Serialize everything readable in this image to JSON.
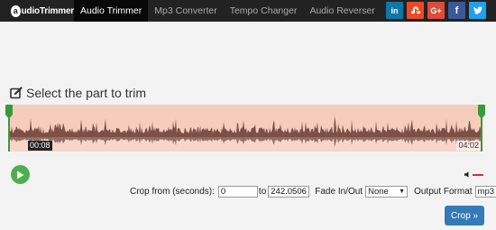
{
  "brand": {
    "logo_letter": "a",
    "logo_text": "udioTrimmer"
  },
  "nav": {
    "items": [
      {
        "label": "Audio Trimmer",
        "active": true
      },
      {
        "label": "Mp3 Converter",
        "active": false
      },
      {
        "label": "Tempo Changer",
        "active": false
      },
      {
        "label": "Audio Reverser",
        "active": false
      }
    ]
  },
  "social": [
    {
      "name": "linkedin",
      "label": "in",
      "color": "#0e76a8"
    },
    {
      "name": "stumbleupon",
      "label": "su",
      "color": "#eb4924"
    },
    {
      "name": "google-plus",
      "label": "G+",
      "color": "#dd4b39"
    },
    {
      "name": "facebook",
      "label": "f",
      "color": "#3b5998"
    },
    {
      "name": "twitter",
      "label": "t",
      "color": "#1da1f2"
    }
  ],
  "editor": {
    "heading": "Select the part to trim",
    "time_start": "00:08",
    "time_end": "04:02"
  },
  "crop": {
    "from_label": "Crop from (seconds):",
    "from_value": "0",
    "to_label": "to",
    "to_value": "242.0506",
    "fade_label": "Fade In/Out",
    "fade_value": "None",
    "format_label": "Output Format",
    "format_value": "mp3",
    "button_label": "Crop »"
  },
  "colors": {
    "accent_green": "#4caf50",
    "wave_bg": "#f6cdbd",
    "wave_fill": "#7d5045",
    "crop_button": "#337ab7"
  }
}
